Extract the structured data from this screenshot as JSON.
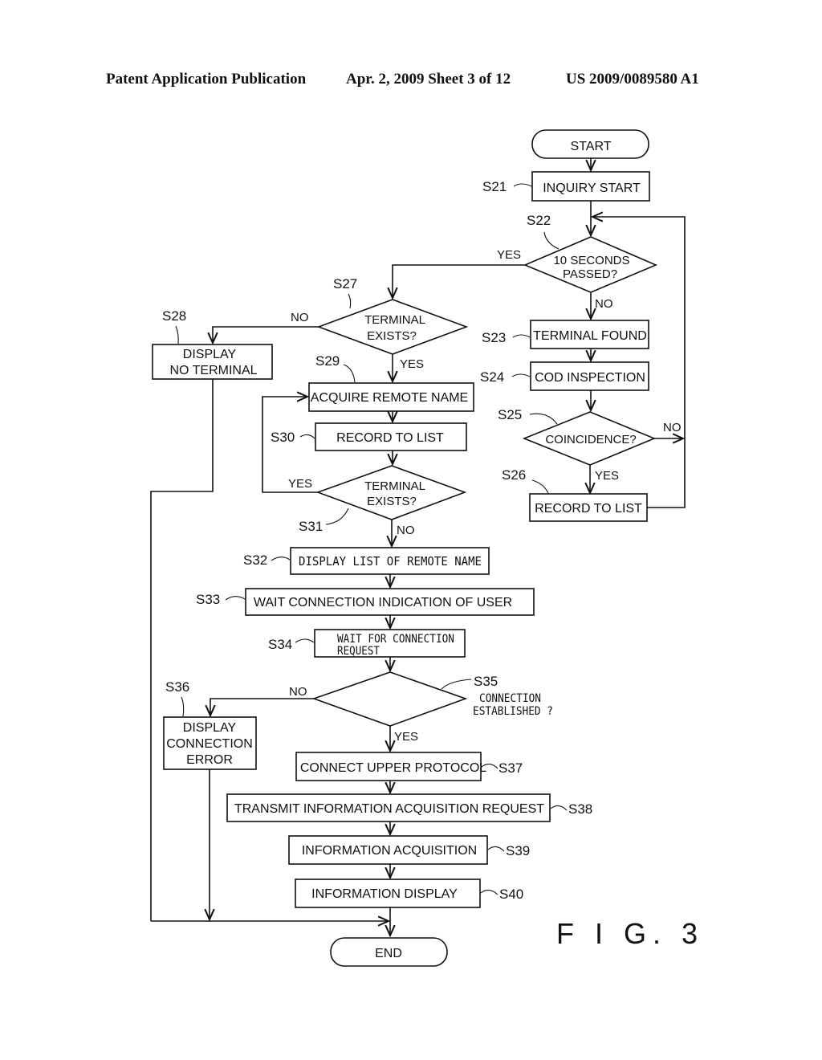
{
  "header": {
    "publication": "Patent Application Publication",
    "date_sheet": "Apr. 2, 2009   Sheet 3 of 12",
    "number": "US 2009/0089580 A1"
  },
  "figure_label": "F I G. 3",
  "nodes": {
    "start": {
      "text": "START"
    },
    "s21": {
      "step": "S21",
      "text": "INQUIRY  START"
    },
    "s22": {
      "step": "S22",
      "line1": "10  SECONDS",
      "line2": "PASSED?"
    },
    "s23": {
      "step": "S23",
      "text": "TERMINAL  FOUND"
    },
    "s24": {
      "step": "S24",
      "text": "COD  INSPECTION"
    },
    "s25": {
      "step": "S25",
      "text": "COINCIDENCE?"
    },
    "s26": {
      "step": "S26",
      "text": "RECORD  TO  LIST"
    },
    "s27": {
      "step": "S27",
      "line1": "TERMINAL",
      "line2": "EXISTS?"
    },
    "s28": {
      "step": "S28",
      "line1": "DISPLAY",
      "line2": "NO  TERMINAL"
    },
    "s29": {
      "step": "S29",
      "text": "ACQUIRE  REMOTE  NAME"
    },
    "s30": {
      "step": "S30",
      "text": "RECORD  TO  LIST"
    },
    "s31": {
      "step": "S31",
      "line1": "TERMINAL",
      "line2": "EXISTS?"
    },
    "s32": {
      "step": "S32",
      "text": "DISPLAY LIST OF REMOTE NAME"
    },
    "s33": {
      "step": "S33",
      "text": "WAIT  CONNECTION  INDICATION  OF  USER"
    },
    "s34": {
      "step": "S34",
      "line1": "WAIT FOR CONNECTION",
      "line2": "REQUEST"
    },
    "s35": {
      "step": "S35",
      "line1": "CONNECTION",
      "line2": "ESTABLISHED ?"
    },
    "s36": {
      "step": "S36",
      "line1": "DISPLAY",
      "line2": "CONNECTION",
      "line3": "ERROR"
    },
    "s37": {
      "step": "S37",
      "text": "CONNECT  UPPER  PROTOCOL"
    },
    "s38": {
      "step": "S38",
      "text": "TRANSMIT  INFORMATION  ACQUISITION  REQUEST"
    },
    "s39": {
      "step": "S39",
      "text": "INFORMATION  ACQUISITION"
    },
    "s40": {
      "step": "S40",
      "text": "INFORMATION  DISPLAY"
    },
    "end": {
      "text": "END"
    }
  },
  "edge_labels": {
    "yes": "YES",
    "no": "NO"
  }
}
